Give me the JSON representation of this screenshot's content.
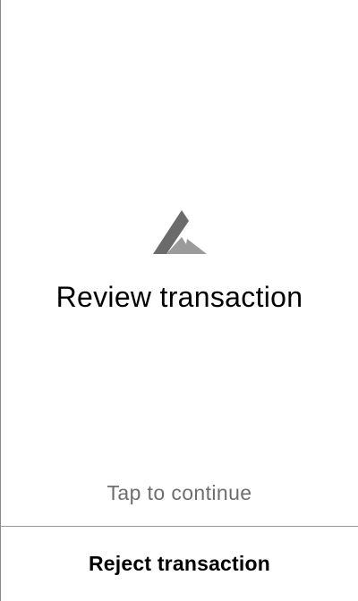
{
  "screen": {
    "logo_icon": "ledger-triangle-logo-icon",
    "title": "Review transaction",
    "hint": "Tap to continue",
    "reject_label": "Reject transaction"
  },
  "colors": {
    "background": "#ffffff",
    "title_text": "#000000",
    "hint_text": "#6e6e6e",
    "logo_dark": "#6b6b6b",
    "logo_light": "#9b9b9b",
    "divider": "#9a9a9a"
  }
}
